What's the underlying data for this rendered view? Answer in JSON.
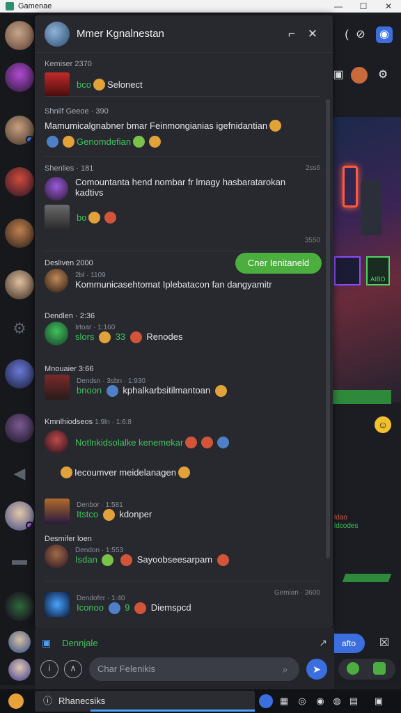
{
  "window": {
    "title": "Gamenae",
    "min": "—",
    "max": "☐",
    "close": "✕"
  },
  "panel": {
    "title": "Mmer Kgnalnestan",
    "groups": [
      {
        "header": "Kemiser 2370",
        "line": "Selonect",
        "prefix": "bco"
      },
      {
        "header": "Shnilf Geeoe · 390",
        "line": "Mamumicalgnabner bmar Feinmongianias igefnidantian",
        "sub": "Genomdefian"
      },
      {
        "header": "Shenlies · 181",
        "stamp": "2ss6",
        "line": "Comountanta hend nombar fr lmagy hasbaratarokan kadtivs",
        "sub": "bo",
        "button": "Cner Ienitaneld",
        "stamp2": "3550"
      },
      {
        "header": "Desliven 2000",
        "sub_header": "2bl · 1109",
        "line": "Kommunicasehtomat Iplebatacon fan dangyamitr"
      },
      {
        "header": "Dendlen · 2:36",
        "sub_header": "Irtoar · 1:160",
        "line_green": "slors",
        "line_num": "33",
        "line": "Renodes"
      },
      {
        "header": "Mnouaier 3:66",
        "sub_header": "Dendsn · 3sbn · 1:930",
        "line_green": "bnoon",
        "line": "kphalkarbsitilmantoan"
      },
      {
        "header": "Kmnlhiodseos",
        "sub_header": "1:9ln · 1:6:8",
        "line_green": "Notlnkidsolalke kenemekar"
      },
      {
        "line": "Iecoumver meidelanagen"
      },
      {
        "sub_header": "Denbor · 1:581",
        "line_green": "Itstco",
        "line": "kdonper"
      },
      {
        "header": "Desmifer loen",
        "sub_header": "Dendon · 1:553",
        "line_green": "Isdan",
        "line": "Sayoobseesarpam"
      },
      {
        "sub_header": "Dendofer · 1:40",
        "stamp": "Gemian · 3600",
        "line_green": "Iconoo",
        "line_num": "9",
        "line": "Diemspcd"
      }
    ],
    "footer_label": "Dennjale",
    "input_placeholder": "Char Felenikis"
  },
  "rightpane": {
    "cab_label": "AIBO",
    "link1": "ldao",
    "link2": "ldcodes",
    "btn": "afto"
  },
  "taskbar": {
    "search": "Rhanecsiks"
  },
  "colors": {
    "accent": "#3b6fe0",
    "green": "#4cae3e",
    "panel": "#27292f"
  }
}
